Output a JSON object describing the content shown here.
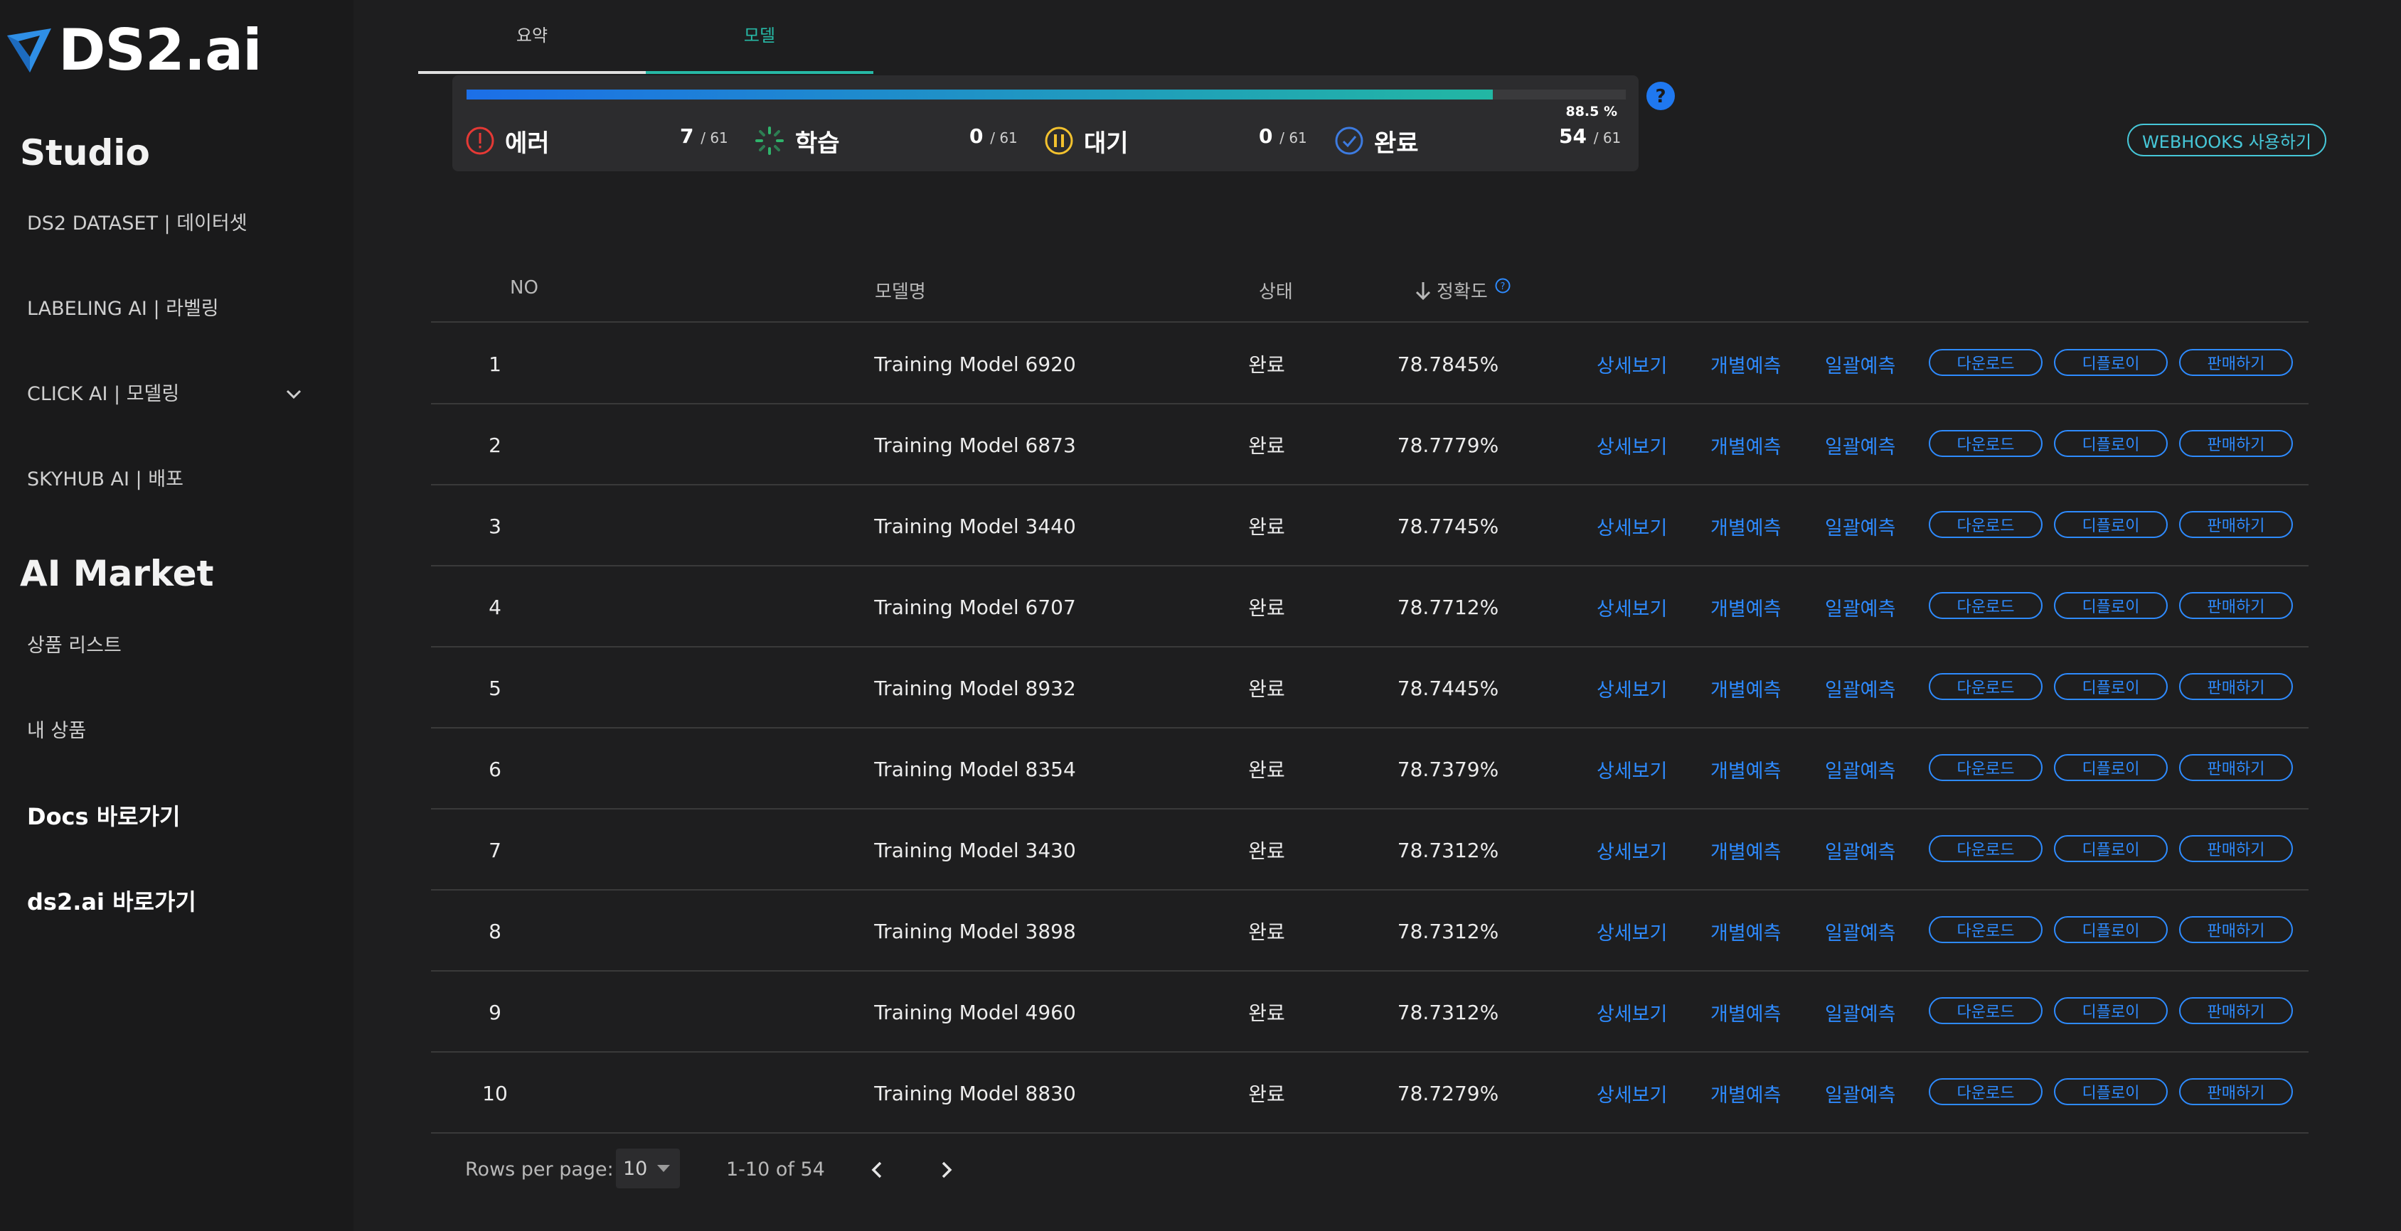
{
  "brand": {
    "name": "DS2.ai"
  },
  "sidebar": {
    "studio_heading": "Studio",
    "studio_items": [
      {
        "label": "DS2 DATASET | 데이터셋"
      },
      {
        "label": "LABELING AI | 라벨링"
      },
      {
        "label": "CLICK AI | 모델링"
      },
      {
        "label": "SKYHUB AI | 배포"
      }
    ],
    "market_heading": "AI Market",
    "market_items": [
      {
        "label": "상품 리스트"
      },
      {
        "label": "내 상품"
      }
    ],
    "links": [
      {
        "label": "Docs 바로가기"
      },
      {
        "label": "ds2.ai 바로가기"
      }
    ]
  },
  "tabs": [
    {
      "label": "요약",
      "active": false
    },
    {
      "label": "모델",
      "active": true
    }
  ],
  "progress": {
    "percent_label": "88.5 %",
    "fraction": 0.885,
    "stats": [
      {
        "label": "에러",
        "count": "7",
        "total": "/ 61",
        "icon": "error-icon",
        "color": "#e53935"
      },
      {
        "label": "학습",
        "count": "0",
        "total": "/ 61",
        "icon": "spinner-icon",
        "color": "#2fb36b"
      },
      {
        "label": "대기",
        "count": "0",
        "total": "/ 61",
        "icon": "pause-icon",
        "color": "#f2c12e"
      },
      {
        "label": "완료",
        "count": "54",
        "total": "/ 61",
        "icon": "check-icon",
        "color": "#3d7be0"
      }
    ]
  },
  "webhooks_button": "WEBHOOKS 사용하기",
  "table": {
    "headers": {
      "no": "NO",
      "model": "모델명",
      "status": "상태",
      "accuracy": "정확도"
    },
    "actions": {
      "detail": "상세보기",
      "single": "개별예측",
      "batch": "일괄예측",
      "download": "다운로드",
      "deploy": "디플로이",
      "sell": "판매하기"
    },
    "rows": [
      {
        "no": "1",
        "model": "Training Model 6920",
        "status": "완료",
        "accuracy": "78.7845%"
      },
      {
        "no": "2",
        "model": "Training Model 6873",
        "status": "완료",
        "accuracy": "78.7779%"
      },
      {
        "no": "3",
        "model": "Training Model 3440",
        "status": "완료",
        "accuracy": "78.7745%"
      },
      {
        "no": "4",
        "model": "Training Model 6707",
        "status": "완료",
        "accuracy": "78.7712%"
      },
      {
        "no": "5",
        "model": "Training Model 8932",
        "status": "완료",
        "accuracy": "78.7445%"
      },
      {
        "no": "6",
        "model": "Training Model 8354",
        "status": "완료",
        "accuracy": "78.7379%"
      },
      {
        "no": "7",
        "model": "Training Model 3430",
        "status": "완료",
        "accuracy": "78.7312%"
      },
      {
        "no": "8",
        "model": "Training Model 3898",
        "status": "완료",
        "accuracy": "78.7312%"
      },
      {
        "no": "9",
        "model": "Training Model 4960",
        "status": "완료",
        "accuracy": "78.7312%"
      },
      {
        "no": "10",
        "model": "Training Model 8830",
        "status": "완료",
        "accuracy": "78.7279%"
      }
    ]
  },
  "pagination": {
    "rows_per_page_label": "Rows per page:",
    "rows_per_page_value": "10",
    "range": "1-10 of 54"
  },
  "colors": {
    "accent_blue": "#2e8bff",
    "teal": "#46c7d8",
    "progress_start": "#1c6fe8",
    "progress_end": "#22b7a3"
  }
}
